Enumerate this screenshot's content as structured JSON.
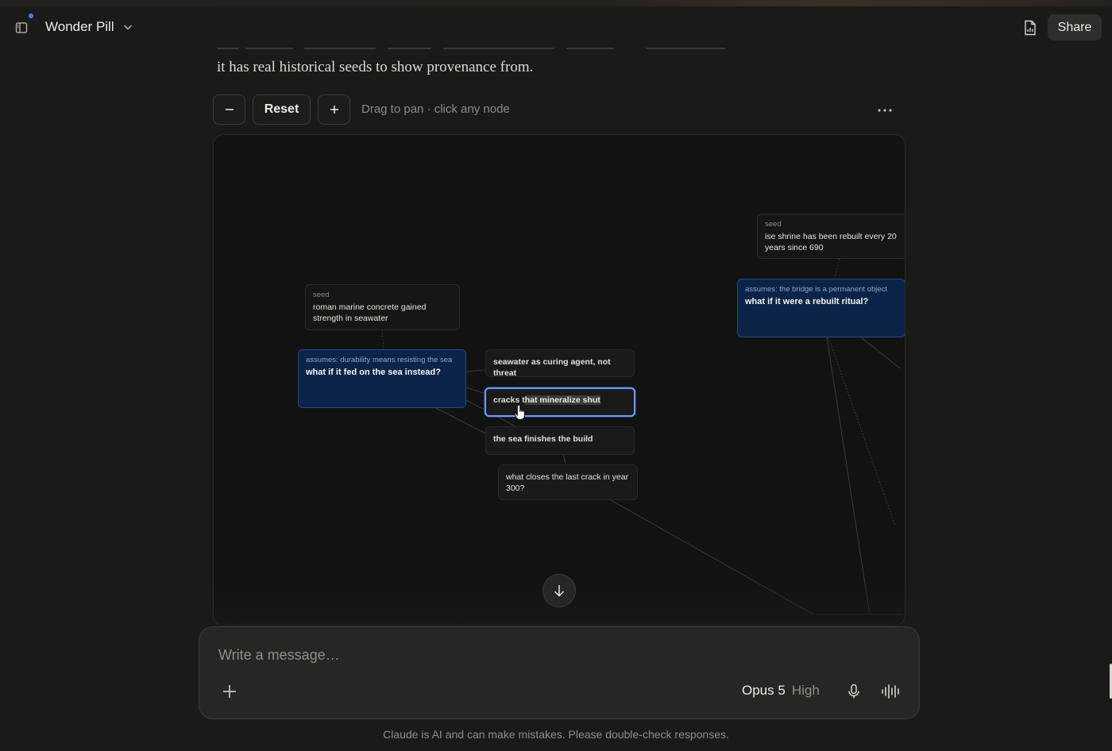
{
  "header": {
    "conversation_title": "Wonder Pill",
    "share_label": "Share",
    "sidebar_icon": "sidebar-toggle-icon",
    "document_icon": "document-icon",
    "notification_dot_color": "#3b82f6"
  },
  "message": {
    "last_line": "it has real historical seeds to show provenance from."
  },
  "graph_toolbar": {
    "zoom_out_label": "–",
    "reset_label": "Reset",
    "zoom_in_label": "+",
    "hint": "Drag to pan · click any node",
    "more_icon": "ellipsis-icon"
  },
  "graph": {
    "nodes": [
      {
        "id": "seed-roman",
        "kind": "seed",
        "text": "roman marine concrete gained strength in seawater"
      },
      {
        "id": "q-sea",
        "kind": "assumes: durability means resisting the sea",
        "text": "what if it fed on the sea instead?"
      },
      {
        "id": "n-curing",
        "text": "seawater as curing agent, not threat"
      },
      {
        "id": "n-cracks",
        "text_before": "cracks t",
        "text_highlight": "hat mineralize shut",
        "selected": true
      },
      {
        "id": "n-finishes",
        "text": "the sea finishes the build"
      },
      {
        "id": "n-closes",
        "text": "what closes the last crack in year 300?"
      },
      {
        "id": "seed-ise",
        "kind": "seed",
        "text": "ise shrine has been rebuilt every 20 years since 690"
      },
      {
        "id": "q-bridge",
        "kind": "assumes: the bridge is a permanent object",
        "text": "what if it were a rebuilt ritual?"
      }
    ],
    "selected_color": "#6b9bf0",
    "question_node_color": "#0c2448"
  },
  "composer": {
    "placeholder": "Write a message…",
    "model": "Opus 5",
    "effort": "High",
    "add_icon": "plus-icon",
    "mic_icon": "microphone-icon",
    "voice_icon": "voice-waveform-icon"
  },
  "footer": {
    "disclaimer": "Claude is AI and can make mistakes. Please double-check responses."
  }
}
